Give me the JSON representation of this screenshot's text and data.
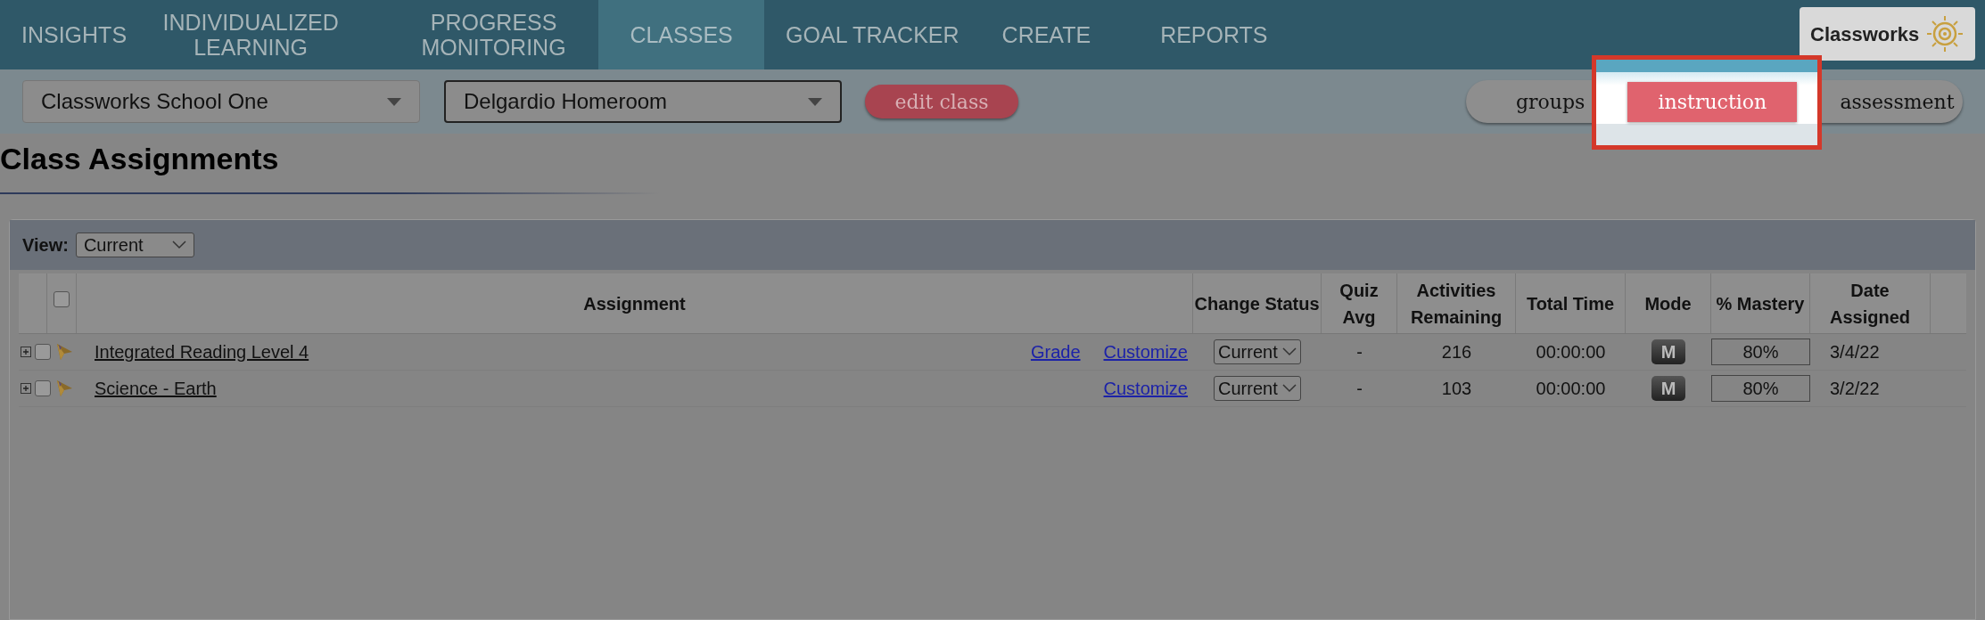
{
  "nav": {
    "tabs": [
      {
        "label": "INSIGHTS",
        "selected": false
      },
      {
        "label": "INDIVIDUALIZED LEARNING",
        "selected": false
      },
      {
        "label": "PROGRESS MONITORING",
        "selected": false
      },
      {
        "label": "CLASSES",
        "selected": true
      },
      {
        "label": "GOAL TRACKER",
        "selected": false
      },
      {
        "label": "CREATE",
        "selected": false
      },
      {
        "label": "REPORTS",
        "selected": false
      }
    ],
    "logo": "Classworks"
  },
  "school_select": "Classworks School One",
  "class_select": "Delgardio Homeroom",
  "edit_button": "edit class",
  "view_toggle": [
    {
      "label": "groups",
      "selected": false,
      "highlighted": false
    },
    {
      "label": "instruction",
      "selected": true,
      "highlighted": true
    },
    {
      "label": "assessment",
      "selected": false,
      "highlighted": false
    }
  ],
  "title": "Class Assignments",
  "view": {
    "label": "View:",
    "value": "Current"
  },
  "table": {
    "header_checkbox": {
      "checked": false
    },
    "columns": [
      "Assignment",
      "Change Status",
      "Quiz Avg",
      "Activities Remaining",
      "Total Time",
      "Mode",
      "% Mastery",
      "Date Assigned"
    ],
    "rows": [
      {
        "checked": false,
        "name": "Integrated Reading Level 4",
        "grade": "Grade",
        "customize": "Customize",
        "status": "Current",
        "quiz_avg": "-",
        "activities": "216",
        "total_time": "00:00:00",
        "mode": "M",
        "mastery": "80%",
        "date": "3/4/22"
      },
      {
        "checked": false,
        "name": "Science - Earth",
        "customize": "Customize",
        "status": "Current",
        "quiz_avg": "-",
        "activities": "103",
        "total_time": "00:00:00",
        "mode": "M",
        "mastery": "80%",
        "date": "3/2/22"
      }
    ]
  }
}
